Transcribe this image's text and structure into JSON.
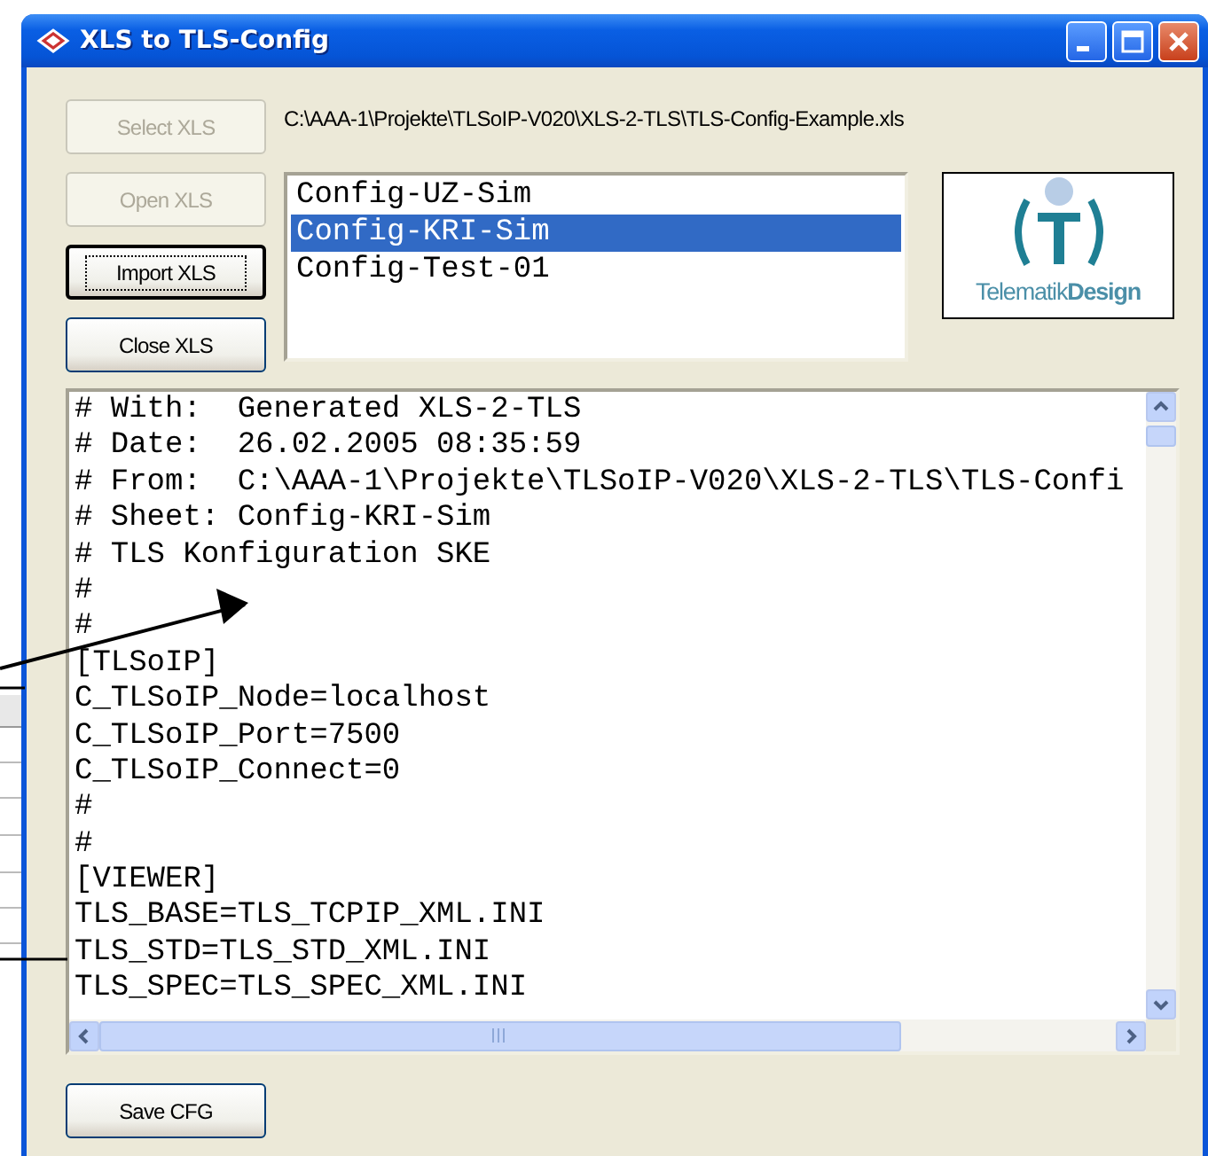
{
  "window": {
    "title": "XLS to TLS-Config"
  },
  "buttons": [
    {
      "label": "Select XLS",
      "disabled": true,
      "focused": false
    },
    {
      "label": "Open XLS",
      "disabled": true,
      "focused": false
    },
    {
      "label": "Import XLS",
      "disabled": false,
      "focused": true
    },
    {
      "label": "Close XLS",
      "disabled": false,
      "focused": false
    }
  ],
  "file_path": "C:\\AAA-1\\Projekte\\TLSoIP-V020\\XLS-2-TLS\\TLS-Config-Example.xls",
  "sheet_list": {
    "items": [
      {
        "label": "Config-UZ-Sim",
        "selected": false
      },
      {
        "label": "Config-KRI-Sim",
        "selected": true
      },
      {
        "label": "Config-Test-01",
        "selected": false
      }
    ]
  },
  "logo": {
    "text": "Telematik**Design**"
  },
  "config_text": {
    "lines": [
      "# With:  Generated XLS-2-TLS",
      "# Date:  26.02.2005 08:35:59",
      "# From:  C:\\AAA-1\\Projekte\\TLSoIP-V020\\XLS-2-TLS\\TLS-Confi",
      "# Sheet: Config-KRI-Sim",
      "# TLS Konfiguration SKE",
      "#",
      "#",
      "[TLSoIP]",
      "C_TLSoIP_Node=localhost",
      "C_TLSoIP_Port=7500",
      "C_TLSoIP_Connect=0",
      "#",
      "#",
      "[VIEWER]",
      "TLS_BASE=TLS_TCPIP_XML.INI",
      "TLS_STD=TLS_STD_XML.INI",
      "TLS_SPEC=TLS_SPEC_XML.INI"
    ]
  },
  "save_button": {
    "label": "Save CFG"
  }
}
